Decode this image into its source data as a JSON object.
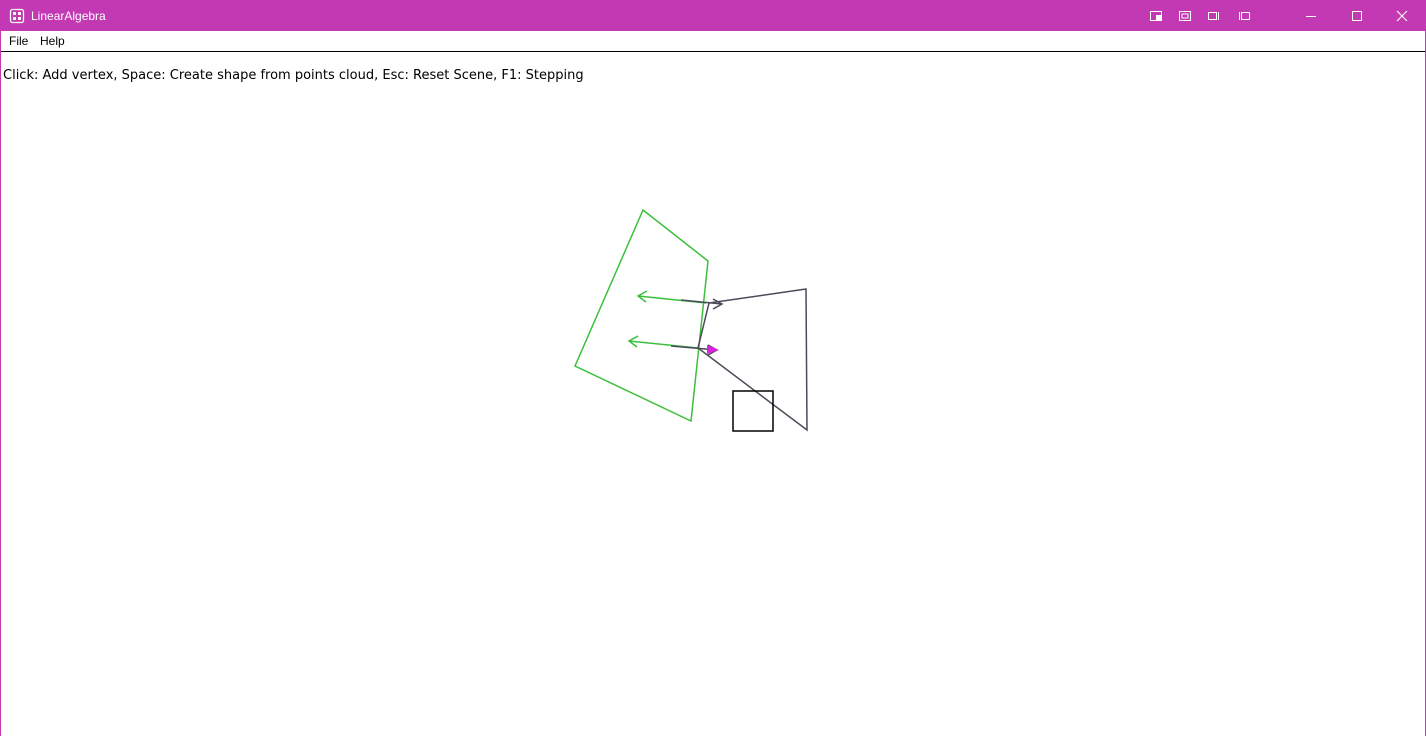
{
  "window": {
    "title": "LinearAlgebra",
    "title_bar_color": "#c239b3",
    "title_icon": "app-grid-icon",
    "extra_buttons": [
      "window-layout-icon-1",
      "window-layout-icon-2",
      "window-layout-icon-3",
      "window-layout-icon-4"
    ],
    "caption_buttons": [
      "minimize-icon",
      "maximize-icon",
      "close-icon"
    ]
  },
  "menu": {
    "file": "File",
    "help": "Help"
  },
  "canvas": {
    "hint": "Click: Add vertex, Space: Create shape from points cloud, Esc: Reset Scene, F1: Stepping",
    "colors": {
      "green_shape": "#3cc03c",
      "dark_shape": "#4a4a5a",
      "square": "#000000",
      "marker": "#e020e0"
    }
  }
}
